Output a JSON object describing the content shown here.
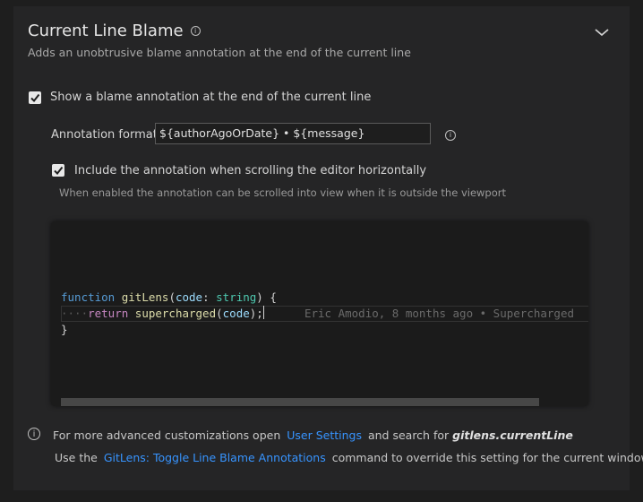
{
  "section": {
    "title": "Current Line Blame",
    "subtitle": "Adds an unobtrusive blame annotation at the end of the current line"
  },
  "settings": {
    "show_annotation_label": "Show a blame annotation at the end of the current line",
    "show_annotation_checked": true,
    "format_label": "Annotation format",
    "format_value": "${authorAgoOrDate} • ${message}",
    "scroll_label": "Include the annotation when scrolling the editor horizontally",
    "scroll_checked": true,
    "scroll_hint": "When enabled the annotation can be scrolled into view when it is outside the viewport"
  },
  "preview": {
    "line1": {
      "keyword": "function",
      "name": "gitLens",
      "param": "code",
      "type": "string"
    },
    "line2": {
      "indent": "····",
      "keyword": "return",
      "call": "supercharged",
      "arg": "code",
      "blame": "Eric Amodio, 8 months ago • Supercharged"
    },
    "line3": "}"
  },
  "footer": {
    "line1_pre": "For more advanced customizations open",
    "line1_link": "User Settings",
    "line1_mid": "and search for",
    "line1_key": "gitlens.currentLine",
    "line2_pre": "Use the",
    "line2_link": "GitLens: Toggle Line Blame Annotations",
    "line2_post": "command to override this setting for the current window"
  },
  "colors": {
    "accent_link": "#3794ff",
    "panel_bg": "#252526",
    "page_bg": "#1e1e1e"
  }
}
